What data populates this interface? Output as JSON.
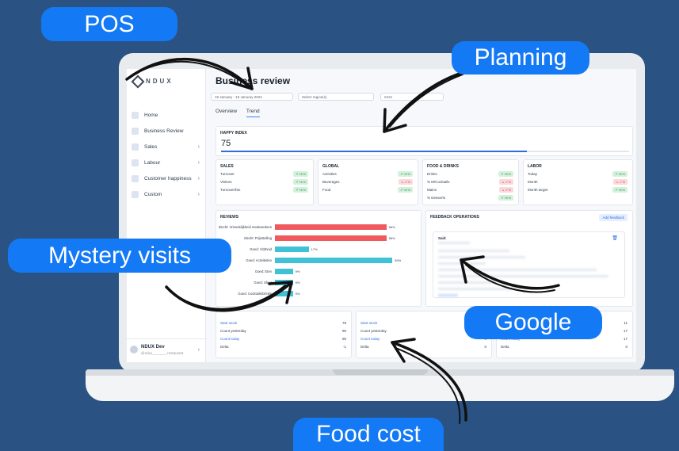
{
  "colors": {
    "background": "#2a5383",
    "pill": "#1479f5",
    "accent": "#2b6ee0",
    "red_bar": "#f05a5f",
    "teal_bar": "#3fc2d6"
  },
  "labels": {
    "pos": "POS",
    "planning": "Planning",
    "mystery": "Mystery visits",
    "google": "Google",
    "food_cost": "Food cost"
  },
  "app": {
    "logo": "NDUX",
    "page_title": "Business review",
    "filters": {
      "date": "19 January - 19 January 2024",
      "region": "Select region(s)",
      "store": "SJ21"
    },
    "tabs": [
      "Overview",
      "Trend"
    ],
    "sidebar": [
      {
        "label": "Home",
        "icon": "home-icon",
        "chevron": false
      },
      {
        "label": "Business Review",
        "icon": "document-icon",
        "chevron": false
      },
      {
        "label": "Sales",
        "icon": "sales-icon",
        "chevron": true
      },
      {
        "label": "Labour",
        "icon": "clock-icon",
        "chevron": true
      },
      {
        "label": "Customer happiness",
        "icon": "star-icon",
        "chevron": true
      },
      {
        "label": "Custom",
        "icon": "custom-icon",
        "chevron": true
      }
    ],
    "user": {
      "name": "NDUX Dev",
      "sub": "@ndux_______.restaurant"
    },
    "happy_index": {
      "title": "HAPPY INDEX",
      "value": "75",
      "progress": 0.75
    },
    "kpis": [
      {
        "title": "SALES",
        "rows": [
          {
            "label": "Turnover",
            "badge": "+8 %",
            "dir": "up"
          },
          {
            "label": "Visitors",
            "badge": "+8 %",
            "dir": "up"
          },
          {
            "label": "Turnover/fan",
            "badge": "+8 %",
            "dir": "up"
          }
        ]
      },
      {
        "title": "GLOBAL",
        "rows": [
          {
            "label": "Activities",
            "badge": "+8 %",
            "dir": "up"
          },
          {
            "label": "Beverages",
            "badge": "-7 %",
            "dir": "down"
          },
          {
            "label": "Food",
            "badge": "+8 %",
            "dir": "up"
          }
        ]
      },
      {
        "title": "FOOD & DRINKS",
        "rows": [
          {
            "label": "Drinks",
            "badge": "+8 %",
            "dir": "up"
          },
          {
            "label": "% M/Cocktails",
            "badge": "-7 %",
            "dir": "down"
          },
          {
            "label": "Mains",
            "badge": "-7 %",
            "dir": "down"
          },
          {
            "label": "% Desserts",
            "badge": "+8 %",
            "dir": "up"
          }
        ]
      },
      {
        "title": "LABOR",
        "rows": [
          {
            "label": "Today",
            "badge": "+8 %",
            "dir": "up"
          },
          {
            "label": "Month",
            "badge": "-7 %",
            "dir": "down"
          },
          {
            "label": "Month target",
            "badge": "+8 %",
            "dir": "up"
          }
        ]
      }
    ],
    "reviews": {
      "title": "REVIEWS",
      "items": [
        {
          "label": "Slecht: Vriendelijkheid medewerkers",
          "value": 56,
          "pct": "56%",
          "color": "red"
        },
        {
          "label": "Slecht: Prijsstelling",
          "value": 56,
          "pct": "56%",
          "color": "red"
        },
        {
          "label": "Goed: Vlotheid",
          "value": 17,
          "pct": "17%",
          "color": "teal"
        },
        {
          "label": "Goed: Activiteiten",
          "value": 59,
          "pct": "59%",
          "color": "teal"
        },
        {
          "label": "Goed: Eten",
          "value": 9,
          "pct": "9%",
          "color": "teal"
        },
        {
          "label": "Goed: Sfeer",
          "value": 9,
          "pct": "9%",
          "color": "teal"
        },
        {
          "label": "Goed: Cocktails/Drinks",
          "value": 9,
          "pct": "9%",
          "color": "teal"
        }
      ]
    },
    "feedback": {
      "title": "FEEDBACK OPERATIONS",
      "add": "Add feedback",
      "author": "Said"
    },
    "stats": [
      {
        "rows": [
          {
            "label": "Start stock",
            "value": "78",
            "link": true
          },
          {
            "label": "Count yesterday",
            "value": "96",
            "link": false
          },
          {
            "label": "Count today",
            "value": "95",
            "link": true
          },
          {
            "label": "Delta",
            "value": "-1",
            "link": false
          }
        ]
      },
      {
        "rows": [
          {
            "label": "Start stock",
            "value": "",
            "link": true
          },
          {
            "label": "Count yesterday",
            "value": "",
            "link": false
          },
          {
            "label": "Count today",
            "value": "0",
            "link": true
          },
          {
            "label": "Delta",
            "value": "0",
            "link": false
          }
        ]
      },
      {
        "rows": [
          {
            "label": "",
            "value": "11",
            "link": true
          },
          {
            "label": "",
            "value": "17",
            "link": false
          },
          {
            "label": "Count today",
            "value": "17",
            "link": true
          },
          {
            "label": "Delta",
            "value": "0",
            "link": false
          }
        ]
      }
    ]
  }
}
